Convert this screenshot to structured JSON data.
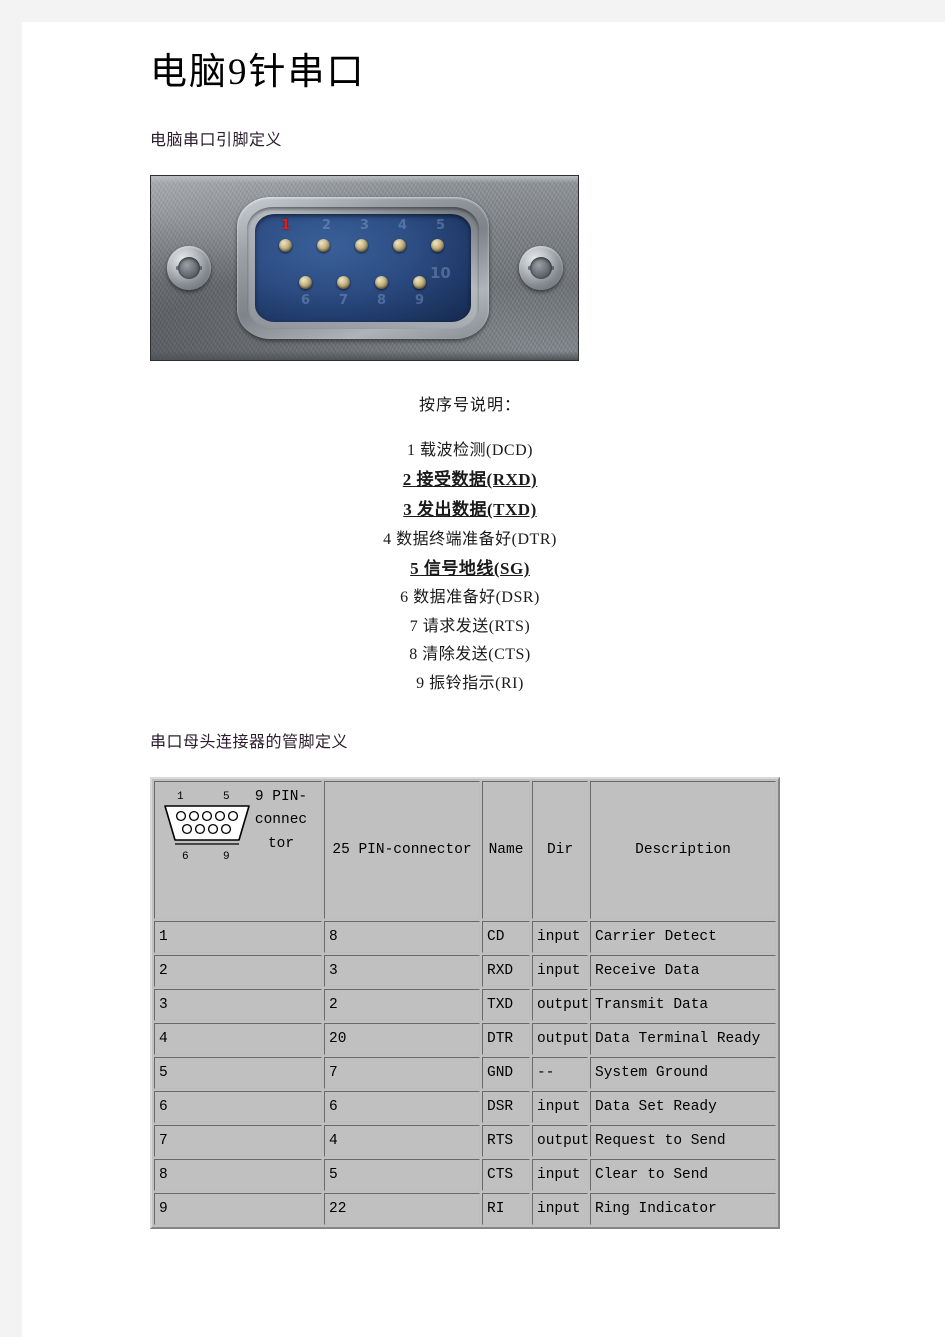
{
  "document": {
    "title": "电脑9针串口",
    "section_pinout_heading": "电脑串口引脚定义",
    "section_female_heading": "串口母头连接器的管脚定义"
  },
  "photo": {
    "alt": "db9-male-connector-photo",
    "marker_label": "1",
    "top_row_numbers": [
      "1",
      "2",
      "3",
      "4",
      "5"
    ],
    "bottom_row_numbers": [
      "6",
      "7",
      "8",
      "9"
    ],
    "extra_number": "10"
  },
  "pin_list": {
    "caption": "按序号说明：",
    "items": [
      {
        "text": "1  载波检测(DCD)",
        "emphasis": false
      },
      {
        "text": "2  接受数据(RXD)",
        "emphasis": true
      },
      {
        "text": "3  发出数据(TXD)",
        "emphasis": true
      },
      {
        "text": "4  数据终端准备好(DTR)",
        "emphasis": false
      },
      {
        "text": "5  信号地线(SG)",
        "emphasis": true
      },
      {
        "text": "6  数据准备好(DSR)",
        "emphasis": false
      },
      {
        "text": "7  请求发送(RTS)",
        "emphasis": false
      },
      {
        "text": "8  清除发送(CTS)",
        "emphasis": false
      },
      {
        "text": "9  振铃指示(RI)",
        "emphasis": false
      }
    ]
  },
  "table": {
    "diagram": {
      "name": "db9-female-diagram",
      "top_left_label": "1",
      "top_right_label": "5",
      "bottom_left_label": "6",
      "bottom_right_label": "9",
      "top_row_holes": 5,
      "bottom_row_holes": 4
    },
    "headers": {
      "col9": "9 PIN-connector",
      "col25": "25 PIN-connector",
      "name": "Name",
      "dir": "Dir",
      "description": "Description"
    },
    "rows": [
      {
        "pin9": "1",
        "pin25": "8",
        "name": "CD",
        "dir": "input",
        "desc": "Carrier Detect"
      },
      {
        "pin9": "2",
        "pin25": "3",
        "name": "RXD",
        "dir": "input",
        "desc": "Receive Data"
      },
      {
        "pin9": "3",
        "pin25": "2",
        "name": "TXD",
        "dir": "output",
        "desc": "Transmit Data"
      },
      {
        "pin9": "4",
        "pin25": "20",
        "name": "DTR",
        "dir": "output",
        "desc": "Data Terminal Ready"
      },
      {
        "pin9": "5",
        "pin25": "7",
        "name": "GND",
        "dir": "--",
        "desc": "System Ground"
      },
      {
        "pin9": "6",
        "pin25": "6",
        "name": "DSR",
        "dir": "input",
        "desc": "Data Set Ready"
      },
      {
        "pin9": "7",
        "pin25": "4",
        "name": "RTS",
        "dir": "output",
        "desc": "Request to Send"
      },
      {
        "pin9": "8",
        "pin25": "5",
        "name": "CTS",
        "dir": "input",
        "desc": "Clear to Send"
      },
      {
        "pin9": "9",
        "pin25": "22",
        "name": "RI",
        "dir": "input",
        "desc": "Ring Indicator"
      }
    ]
  },
  "colors": {
    "page_background": "#ffffff",
    "outer_margin": "#f3f3f4",
    "heading_text": "#2b1c2e",
    "table_cell_background": "#c0c0c0",
    "marker_red": "#e21b16",
    "insulator_blue": "#2d4d84"
  }
}
